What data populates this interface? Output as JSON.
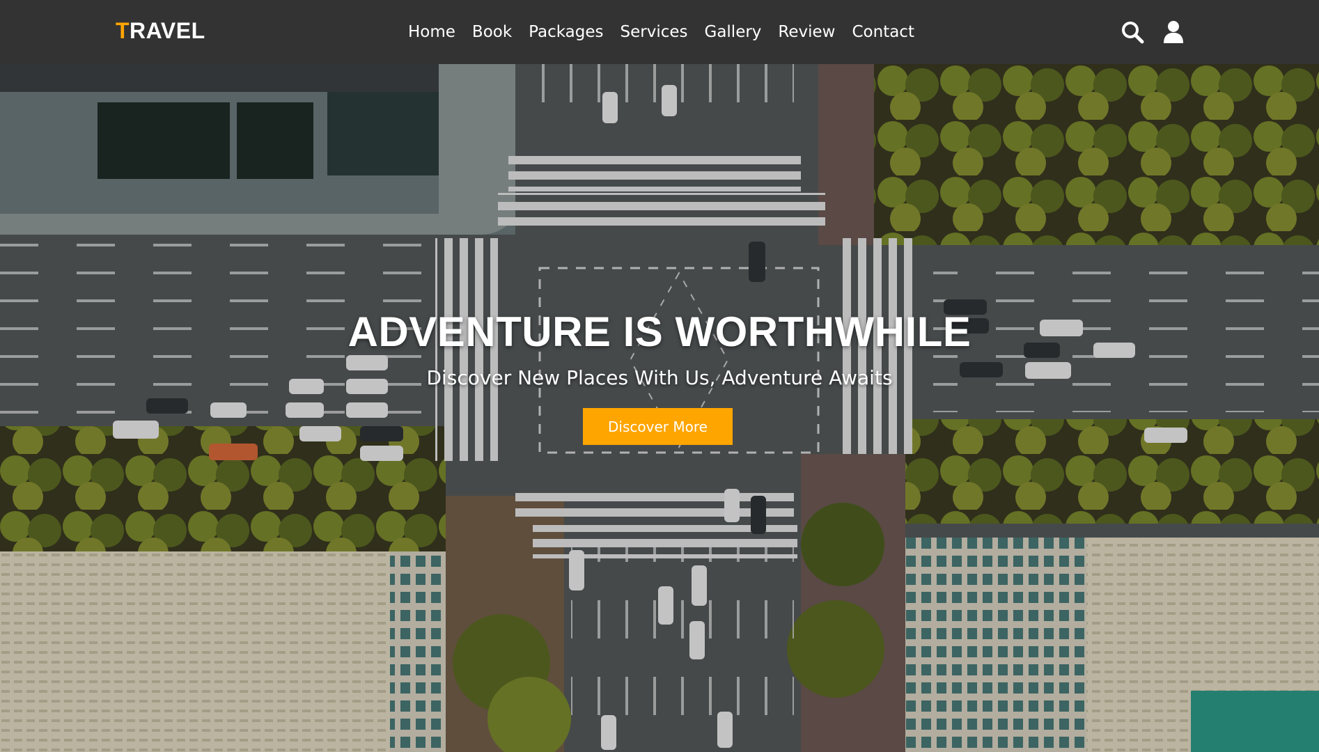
{
  "header": {
    "logo_first_letter": "T",
    "logo_rest": "RAVEL",
    "nav": [
      {
        "label": "Home"
      },
      {
        "label": "Book"
      },
      {
        "label": "Packages"
      },
      {
        "label": "Services"
      },
      {
        "label": "Gallery"
      },
      {
        "label": "Review"
      },
      {
        "label": "Contact"
      }
    ],
    "icons": {
      "search": "search-icon",
      "user": "user-icon"
    }
  },
  "hero": {
    "title": "ADVENTURE IS WORTHWHILE",
    "subtitle": "Discover New Places With Us, Adventure Awaits",
    "button_label": "Discover More"
  },
  "colors": {
    "header_bg": "#333333",
    "accent": "#ffa500",
    "text": "#ffffff"
  }
}
